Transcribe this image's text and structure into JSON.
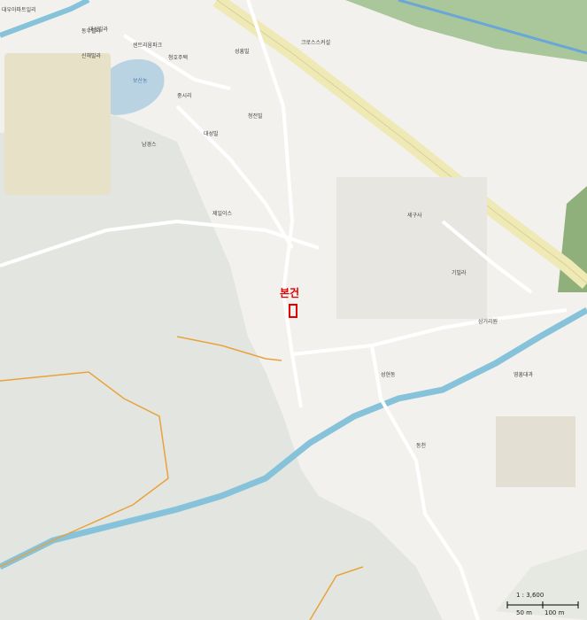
{
  "map": {
    "subject_label": "본건",
    "scale_ratio": "1 : 3,600",
    "scale_left": "50 m",
    "scale_right": "100 m",
    "colors": {
      "background": "#f2f1ee",
      "mountain": "#e3e6e0",
      "river": "#86c3da",
      "green_belt": "#7fa86c",
      "highway": "#efe9b5",
      "trail": "#e9a23b",
      "subject_marker": "#e00000"
    },
    "labels": [
      "대우아파트일리",
      "동우빌라",
      "신해빌라",
      "센트리움파크",
      "대성빌라",
      "청호주택",
      "초원주택",
      "동흥빌라",
      "신축소유지",
      "크로스스커설",
      "성흥빌",
      "보산농",
      "화장대방",
      "청전빌",
      "대성빌",
      "레사니빌",
      "중시리",
      "남경스",
      "영흥대과",
      "제일이스",
      "소이동",
      "성현동",
      "동천",
      "세구사",
      "기빌라",
      "삼거리원"
    ],
    "label_groups": {
      "a": [
        "대우아파트일리",
        "동우빌라",
        "신해빌라",
        "센트리움파크",
        "대성빌라"
      ],
      "b": [
        "크로스스커설",
        "성흥빌",
        "보산농",
        "청전빌",
        "대성빌",
        "제일이스",
        "중시리"
      ],
      "c": [
        "남경스",
        "세구사",
        "기빌라",
        "삼거리원",
        "성현동",
        "동천",
        "영흥대과"
      ]
    },
    "place_labels": [
      {
        "text": "대우아파트일리",
        "cls": ""
      },
      {
        "text": "동우빌라",
        "cls": ""
      },
      {
        "text": "신해빌라",
        "cls": ""
      },
      {
        "text": "센트리움파크",
        "cls": ""
      },
      {
        "text": "대성빌라",
        "cls": ""
      },
      {
        "text": "청호주택",
        "cls": ""
      },
      {
        "text": "크로스스커설",
        "cls": ""
      },
      {
        "text": "성흥빌",
        "cls": ""
      },
      {
        "text": "보산농",
        "cls": "blue"
      },
      {
        "text": "청전빌",
        "cls": ""
      },
      {
        "text": "대성빌",
        "cls": ""
      },
      {
        "text": "제일이스",
        "cls": ""
      },
      {
        "text": "중시리",
        "cls": ""
      },
      {
        "text": "남경스",
        "cls": ""
      },
      {
        "text": "세구사",
        "cls": ""
      },
      {
        "text": "기빌라",
        "cls": ""
      },
      {
        "text": "삼거리원",
        "cls": ""
      },
      {
        "text": "성현동",
        "cls": ""
      },
      {
        "text": "동천",
        "cls": ""
      },
      {
        "text": "영흥대과",
        "cls": ""
      }
    ]
  }
}
